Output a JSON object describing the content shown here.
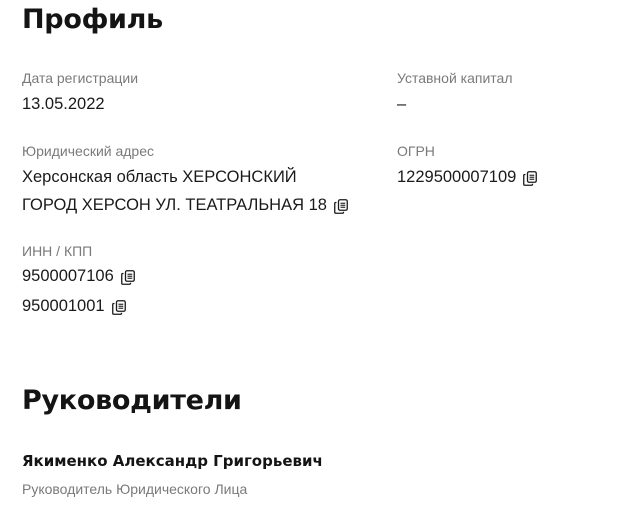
{
  "profile": {
    "title": "Профиль",
    "registration_date": {
      "label": "Дата регистрации",
      "value": "13.05.2022"
    },
    "authorized_capital": {
      "label": "Уставной капитал",
      "value": "–"
    },
    "legal_address": {
      "label": "Юридический адрес",
      "line1": "Херсонская область ХЕРСОНСКИЙ",
      "line2": "ГОРОД ХЕРСОН УЛ. ТЕАТРАЛЬНАЯ 18"
    },
    "ogrn": {
      "label": "ОГРН",
      "value": "1229500007109"
    },
    "inn_kpp": {
      "label": "ИНН / КПП",
      "inn": "9500007106",
      "kpp": "950001001"
    }
  },
  "managers": {
    "title": "Руководители",
    "items": [
      {
        "name": "Якименко Александр Григорьевич",
        "role": "Руководитель Юридического Лица"
      }
    ]
  },
  "icons": {
    "copy": "copy-icon"
  },
  "colors": {
    "text": "#1a1a1a",
    "muted": "#7a7a7a",
    "heading": "#141414",
    "background": "#ffffff"
  }
}
